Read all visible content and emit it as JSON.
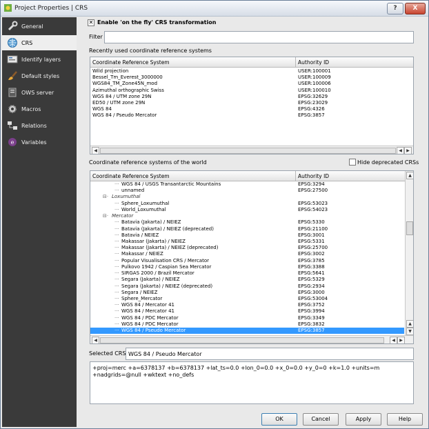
{
  "window": {
    "title": "Project Properties | CRS",
    "help_label": "?",
    "close_label": "X"
  },
  "sidebar": {
    "items": [
      {
        "label": "General",
        "icon": "wrench-icon"
      },
      {
        "label": "CRS",
        "icon": "globe-icon"
      },
      {
        "label": "Identify layers",
        "icon": "identify-icon"
      },
      {
        "label": "Default styles",
        "icon": "brush-icon"
      },
      {
        "label": "OWS server",
        "icon": "ows-server-icon"
      },
      {
        "label": "Macros",
        "icon": "gear-icon"
      },
      {
        "label": "Relations",
        "icon": "relations-icon"
      },
      {
        "label": "Variables",
        "icon": "variables-icon"
      }
    ],
    "active_index": 1
  },
  "crs": {
    "enable_otf_label": "Enable 'on the fly' CRS transformation",
    "enable_otf_checked": true,
    "filter_label": "Filter",
    "filter_value": "",
    "recent_label": "Recently used coordinate reference systems",
    "world_label": "Coordinate reference systems of the world",
    "hide_deprecated_label": "Hide deprecated CRSs",
    "hide_deprecated_checked": false,
    "col_system": "Coordinate Reference System",
    "col_authority": "Authority ID",
    "recent_rows": [
      {
        "name": "Wild projection",
        "auth": "USER:100001"
      },
      {
        "name": "Bessel_Tm_Everest_3000000",
        "auth": "USER:100009"
      },
      {
        "name": "WGS84_TM_Zone45N_mod",
        "auth": "USER:100006"
      },
      {
        "name": "Azimuthal orthographic Swiss",
        "auth": "USER:100010"
      },
      {
        "name": "WGS 84 / UTM zone 29N",
        "auth": "EPSG:32629"
      },
      {
        "name": "ED50 / UTM zone 29N",
        "auth": "EPSG:23029"
      },
      {
        "name": "WGS 84",
        "auth": "EPSG:4326"
      },
      {
        "name": "WGS 84 / Pseudo Mercator",
        "auth": "EPSG:3857"
      }
    ],
    "world_rows": [
      {
        "name": "WGS 84 / USGS Transantarctic Mountains",
        "auth": "EPSG:3294"
      },
      {
        "name": "unnamed",
        "auth": "EPSG:27500"
      },
      {
        "name": "Loxumuthal",
        "auth": "",
        "group": true
      },
      {
        "name": "Sphere_Loxumuthal",
        "auth": "EPSG:53023"
      },
      {
        "name": "World_Loxumuthal",
        "auth": "EPSG:54023"
      },
      {
        "name": "Mercator",
        "auth": "",
        "group": true
      },
      {
        "name": "Batavia (Jakarta) / NEIEZ",
        "auth": "EPSG:5330"
      },
      {
        "name": "Batavia (Jakarta) / NEIEZ (deprecated)",
        "auth": "EPSG:21100"
      },
      {
        "name": "Batavia / NEIEZ",
        "auth": "EPSG:3001"
      },
      {
        "name": "Makassar (Jakarta) / NEIEZ",
        "auth": "EPSG:5331"
      },
      {
        "name": "Makassar (Jakarta) / NEIEZ (deprecated)",
        "auth": "EPSG:25700"
      },
      {
        "name": "Makassar / NEIEZ",
        "auth": "EPSG:3002"
      },
      {
        "name": "Popular Visualisation CRS / Mercator",
        "auth": "EPSG:3785"
      },
      {
        "name": "Pulkovo 1942 / Caspian Sea Mercator",
        "auth": "EPSG:3388"
      },
      {
        "name": "SIRGAS 2000 / Brazil Mercator",
        "auth": "EPSG:5641"
      },
      {
        "name": "Segara (Jakarta) / NEIEZ",
        "auth": "EPSG:5329"
      },
      {
        "name": "Segara (Jakarta) / NEIEZ (deprecated)",
        "auth": "EPSG:2934"
      },
      {
        "name": "Segara / NEIEZ",
        "auth": "EPSG:3000"
      },
      {
        "name": "Sphere_Mercator",
        "auth": "EPSG:53004"
      },
      {
        "name": "WGS 84 / Mercator 41",
        "auth": "EPSG:3752"
      },
      {
        "name": "WGS 84 / Mercator 41",
        "auth": "EPSG:3994"
      },
      {
        "name": "WGS 84 / PDC Mercator",
        "auth": "EPSG:3349"
      },
      {
        "name": "WGS 84 / PDC Mercator",
        "auth": "EPSG:3832"
      },
      {
        "name": "WGS 84 / Pseudo Mercator",
        "auth": "EPSG:3857",
        "selected": true
      }
    ],
    "selected_crs_label": "Selected CRS:",
    "selected_crs_value": "WGS 84 / Pseudo Mercator",
    "proj_string": "+proj=merc +a=6378137 +b=6378137 +lat_ts=0.0 +lon_0=0.0 +x_0=0.0 +y_0=0 +k=1.0 +units=m +nadgrids=@null +wktext +no_defs"
  },
  "buttons": {
    "ok": "OK",
    "cancel": "Cancel",
    "apply": "Apply",
    "help": "Help"
  },
  "colors": {
    "sidebar_bg": "#3a3a3a",
    "selection": "#3399ff"
  }
}
